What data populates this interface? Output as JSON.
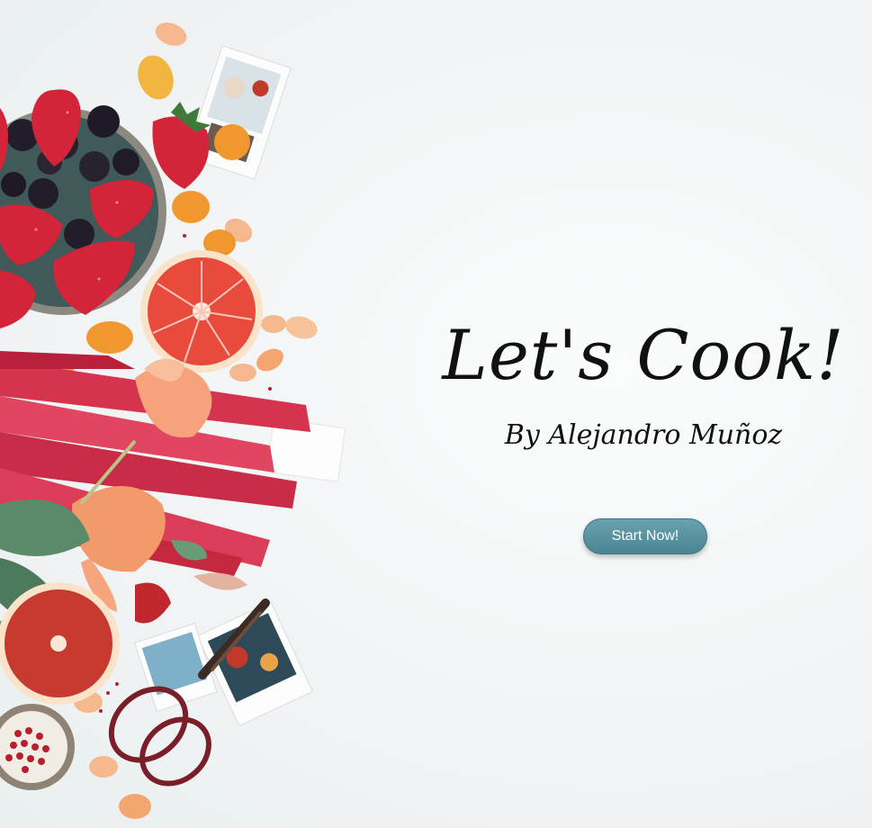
{
  "hero": {
    "title": "Let's Cook!",
    "subtitle": "By Alejandro Muñoz",
    "cta_label": "Start Now!"
  },
  "theme": {
    "button_color": "#5a93a0",
    "text_color": "#111111",
    "background": "#f2f5f5"
  },
  "image": {
    "subject": "food-photo-still-life"
  }
}
